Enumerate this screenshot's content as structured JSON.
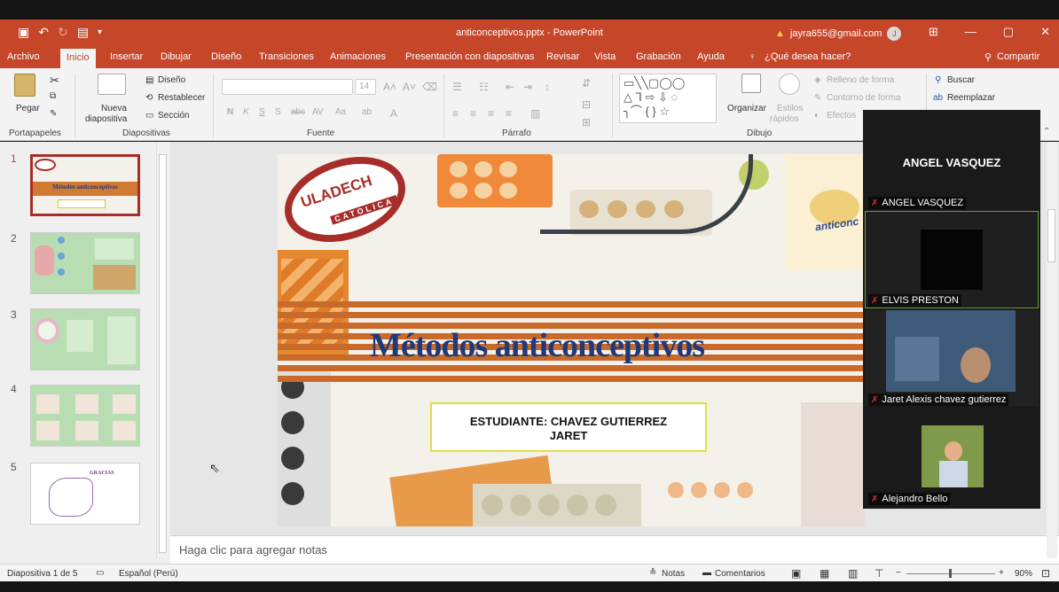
{
  "window": {
    "title": "anticonceptivos.pptx  -  PowerPoint",
    "account_email": "jayra655@gmail.com",
    "account_initial": "J",
    "warning_icon": "warning-icon"
  },
  "tabs": [
    "Archivo",
    "Inicio",
    "Insertar",
    "Dibujar",
    "Diseño",
    "Transiciones",
    "Animaciones",
    "Presentación con diapositivas",
    "Revisar",
    "Vista",
    "Grabación",
    "Ayuda"
  ],
  "search_prompt": "¿Qué desea hacer?",
  "share_label": "Compartir",
  "ribbon": {
    "clipboard": {
      "paste": "Pegar",
      "group": "Portapapeles"
    },
    "slides": {
      "new_slide_1": "Nueva",
      "new_slide_2": "diapositiva",
      "layout": "Diseño",
      "reset": "Restablecer",
      "section": "Sección",
      "group": "Diapositivas"
    },
    "font": {
      "size": "14",
      "bold": "N",
      "italic": "K",
      "underline": "S",
      "strike": "S",
      "spacing": "abc",
      "case": "Aa",
      "group": "Fuente"
    },
    "paragraph": {
      "group": "Párrafo"
    },
    "drawing": {
      "arrange": "Organizar",
      "quick_styles_1": "Estilos",
      "quick_styles_2": "rápidos",
      "fill": "Relleno de forma",
      "outline": "Contorno de forma",
      "effects": "Efectos",
      "group": "Dibujo"
    },
    "editing": {
      "find": "Buscar",
      "replace": "Reemplazar"
    }
  },
  "thumbnails": [
    {
      "num": "1",
      "caption": "Métodos anticonceptivos"
    },
    {
      "num": "2",
      "caption": ""
    },
    {
      "num": "3",
      "caption": ""
    },
    {
      "num": "4",
      "caption": ""
    },
    {
      "num": "5",
      "caption": "GRACIAS"
    }
  ],
  "slide": {
    "logo_top": "ULADECH",
    "logo_bottom": "CATOLICA",
    "title": "Métodos anticonceptivos",
    "student_line1": "ESTUDIANTE: CHAVEZ GUTIERREZ",
    "student_line2": "JARET",
    "sticker_text": "anticonc"
  },
  "notes_placeholder": "Haga clic para agregar notas",
  "status": {
    "slide_counter": "Diapositiva 1 de 5",
    "language": "Español (Perú)",
    "notes": "Notas",
    "comments": "Comentarios",
    "zoom": "90%"
  },
  "zoom_panel": {
    "speaker_name": "ANGEL VASQUEZ",
    "participants": [
      "ANGEL VASQUEZ",
      "ELVIS PRESTON",
      "Jaret Alexis chavez gutierrez",
      "Alejandro Bello"
    ]
  },
  "colors": {
    "accent": "#c6462a",
    "slide_stripe": "#c96a2b",
    "title_blue": "#1f3a7a",
    "selected_thumb": "#a62d2a"
  }
}
